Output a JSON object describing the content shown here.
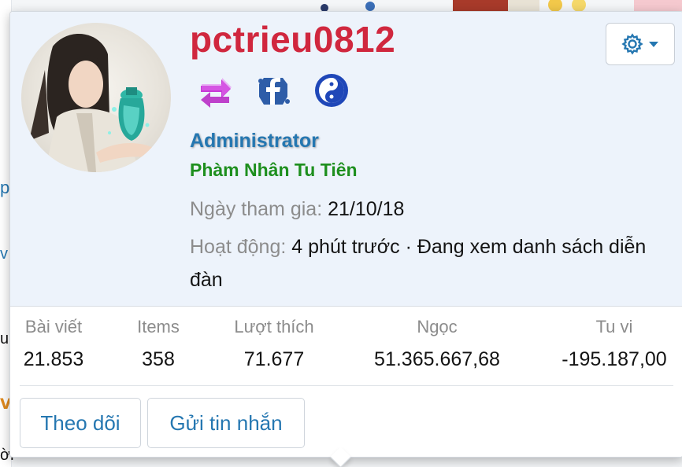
{
  "profile": {
    "username": "pctrieu0812",
    "role": "Administrator",
    "rank": "Phàm Nhân Tu Tiên",
    "joined_label": "Ngày tham gia:",
    "joined_value": "21/10/18",
    "activity_label": "Hoạt động:",
    "activity_value": "4 phút trước · Đang xem danh sách diễn đàn"
  },
  "badges": [
    {
      "icon": "swap-arrows-icon",
      "color": "#c73bd6"
    },
    {
      "icon": "facebook-icon",
      "color": "#2e5da8"
    },
    {
      "icon": "yin-yang-icon",
      "color": "#1f47b8"
    }
  ],
  "settings": {
    "icon": "gear-icon",
    "caret": "caret-down-icon",
    "color": "#2577b1"
  },
  "stats": [
    {
      "label": "Bài viết",
      "value": "21.853"
    },
    {
      "label": "Items",
      "value": "358"
    },
    {
      "label": "Lượt thích",
      "value": "71.677"
    },
    {
      "label": "Ngọc",
      "value": "51.365.667,68"
    },
    {
      "label": "Tu vi",
      "value": "-195.187,00"
    }
  ],
  "actions": {
    "follow": "Theo dõi",
    "message": "Gửi tin nhắn"
  },
  "background": {
    "side_letters": [
      "p",
      "v",
      "u",
      "v",
      "ời"
    ]
  },
  "colors": {
    "username": "#d0273e",
    "link": "#2577b1",
    "rank": "#1e8f1e",
    "card_top": "#edf3fb"
  }
}
